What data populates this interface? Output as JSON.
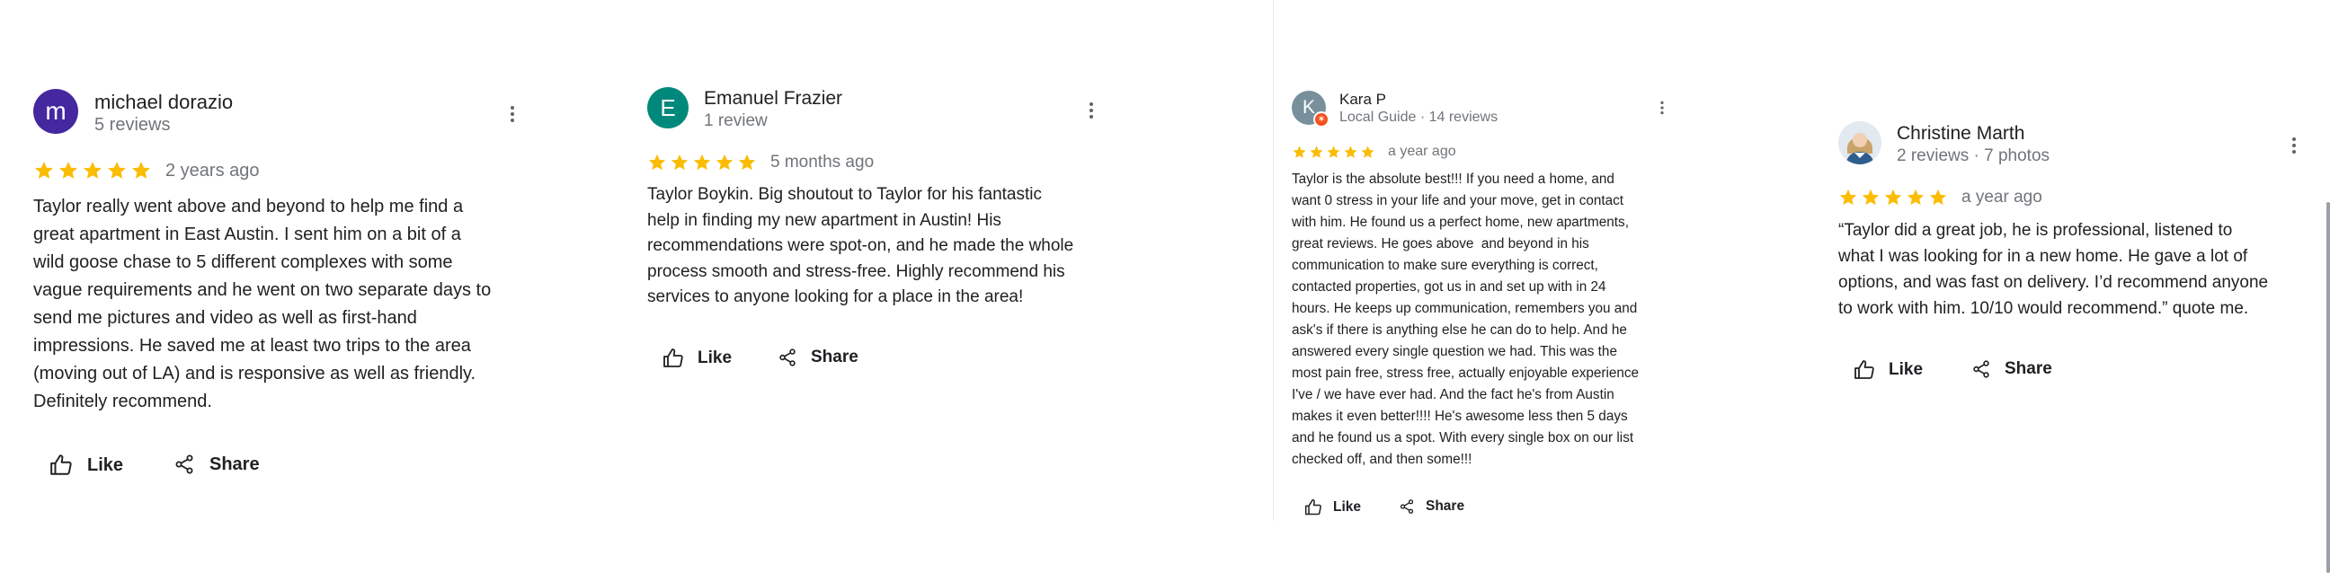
{
  "reviews": [
    {
      "avatar_letter": "m",
      "avatar_color": "#4527a0",
      "name": "michael dorazio",
      "meta": "5 reviews",
      "stars": 5,
      "time": "2 years ago",
      "text": "Taylor really went above and beyond to help me find a\ngreat apartment in East Austin. I sent him on a bit of a\nwild goose chase to 5 different complexes with some\nvague requirements and he went on two separate days to\nsend me pictures and video as well as first-hand\nimpressions. He saved me at least two trips to the area\n(moving out of LA) and is responsive as well as friendly.\nDefinitely recommend.",
      "like_label": "Like",
      "share_label": "Share"
    },
    {
      "avatar_letter": "E",
      "avatar_color": "#00897b",
      "name": "Emanuel Frazier",
      "meta": "1 review",
      "stars": 5,
      "time": "5 months ago",
      "text": "Taylor Boykin. Big shoutout to Taylor for his fantastic\nhelp in finding my new apartment in Austin! His\nrecommendations were spot-on, and he made the whole\nprocess smooth and stress-free. Highly recommend his\nservices to anyone looking for a place in the area!",
      "like_label": "Like",
      "share_label": "Share"
    },
    {
      "avatar_letter": "K",
      "avatar_color": "#78909c",
      "local_guide_badge_color": "#f4511e",
      "name": "Kara P",
      "meta": "Local Guide · 14 reviews",
      "stars": 5,
      "time": "a year ago",
      "text": "Taylor is the absolute best!!! If you need a home, and\nwant 0 stress in your life and your move, get in contact\nwith him. He found us a perfect home, new apartments,\ngreat reviews. He goes above  and beyond in his\ncommunication to make sure everything is correct,\ncontacted properties, got us in and set up with in 24\nhours. He keeps up communication, remembers you and\nask's if there is anything else he can do to help. And he\nanswered every single question we had. This was the\nmost pain free, stress free, actually enjoyable experience\nI've / we have ever had. And the fact he's from Austin\nmakes it even better!!!! He's awesome less then 5 days\nand he found us a spot. With every single box on our list\nchecked off, and then some!!!",
      "like_label": "Like",
      "share_label": "Share"
    },
    {
      "avatar_photo": true,
      "name": "Christine Marth",
      "meta": "2 reviews · 7 photos",
      "stars": 5,
      "time": "a year ago",
      "text": "“Taylor did a great job, he is professional, listened to\nwhat I was looking for in a new home. He gave a lot of\noptions, and was fast on delivery. I’d recommend anyone\nto work with him. 10/10 would recommend.” quote me.",
      "like_label": "Like",
      "share_label": "Share"
    }
  ],
  "colors": {
    "star": "#fbbc04",
    "muted": "#70757a",
    "text": "#202124"
  },
  "icons": {
    "menu": "more-vert-icon",
    "like": "thumb-up-icon",
    "share": "share-icon",
    "star": "star-icon"
  }
}
